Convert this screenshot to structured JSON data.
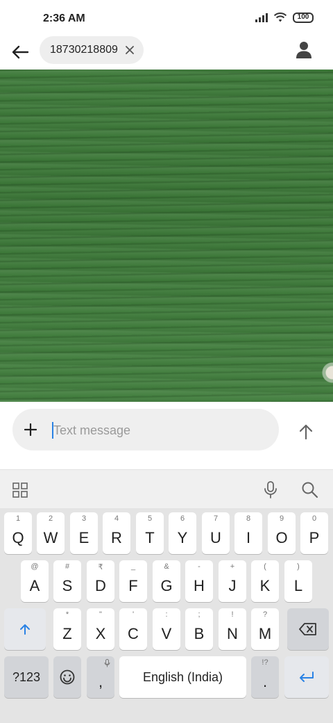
{
  "status": {
    "time": "2:36 AM",
    "battery": "100"
  },
  "header": {
    "recipient": "18730218809"
  },
  "compose": {
    "placeholder": "Text message",
    "value": ""
  },
  "keyboard": {
    "row1": [
      {
        "hint": "1",
        "label": "Q"
      },
      {
        "hint": "2",
        "label": "W"
      },
      {
        "hint": "3",
        "label": "E"
      },
      {
        "hint": "4",
        "label": "R"
      },
      {
        "hint": "5",
        "label": "T"
      },
      {
        "hint": "6",
        "label": "Y"
      },
      {
        "hint": "7",
        "label": "U"
      },
      {
        "hint": "8",
        "label": "I"
      },
      {
        "hint": "9",
        "label": "O"
      },
      {
        "hint": "0",
        "label": "P"
      }
    ],
    "row2": [
      {
        "hint": "@",
        "label": "A"
      },
      {
        "hint": "#",
        "label": "S"
      },
      {
        "hint": "₹",
        "label": "D"
      },
      {
        "hint": "_",
        "label": "F"
      },
      {
        "hint": "&",
        "label": "G"
      },
      {
        "hint": "-",
        "label": "H"
      },
      {
        "hint": "+",
        "label": "J"
      },
      {
        "hint": "(",
        "label": "K"
      },
      {
        "hint": ")",
        "label": "L"
      }
    ],
    "row3": [
      {
        "hint": "*",
        "label": "Z"
      },
      {
        "hint": "\"",
        "label": "X"
      },
      {
        "hint": "'",
        "label": "C"
      },
      {
        "hint": ":",
        "label": "V"
      },
      {
        "hint": ";",
        "label": "B"
      },
      {
        "hint": "!",
        "label": "N"
      },
      {
        "hint": "?",
        "label": "M"
      }
    ],
    "symbols_label": "?123",
    "comma_label": ",",
    "space_label": "English (India)",
    "period_hint": "!?",
    "period_label": "."
  },
  "colors": {
    "accent": "#2a82e4",
    "image_green": "#3e7a3a",
    "keyboard_bg": "#e4e4e4"
  },
  "icons": [
    "back-arrow-icon",
    "close-icon",
    "contact-icon",
    "plus-icon",
    "send-arrow-icon",
    "apps-grid-icon",
    "microphone-icon",
    "search-icon",
    "shift-icon",
    "backspace-icon",
    "emoji-icon",
    "enter-icon"
  ]
}
